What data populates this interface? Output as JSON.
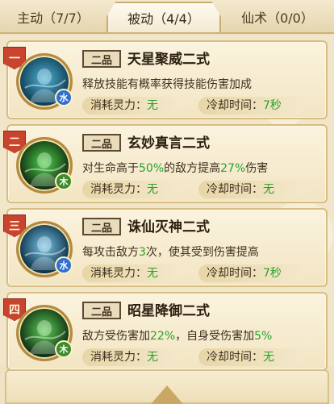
{
  "tabs": [
    {
      "label": "主动（7/7）"
    },
    {
      "label": "被动（4/4）"
    },
    {
      "label": "仙术（0/0）"
    }
  ],
  "active_tab": 1,
  "cost_label": "消耗灵力：",
  "cooldown_label": "冷却时间：",
  "skills": [
    {
      "rank": "一",
      "grade": "二品",
      "name": "天星聚威二式",
      "desc": [
        {
          "t": "释放技能有概率获得技能伤害加成"
        }
      ],
      "element": "水",
      "element_color": "#2f6fd0",
      "cost": "无",
      "cooldown": "7秒",
      "icon": "water-spirit-icon",
      "icon_colors": [
        "#0e3a52",
        "#4fb4d6"
      ]
    },
    {
      "rank": "二",
      "grade": "二品",
      "name": "玄妙真言二式",
      "desc": [
        {
          "t": "对生命高于"
        },
        {
          "t": "50%",
          "hl": true
        },
        {
          "t": "的敌方提高"
        },
        {
          "t": "27%",
          "hl": true
        },
        {
          "t": "伤害"
        }
      ],
      "element": "木",
      "element_color": "#3f8a2c",
      "cost": "无",
      "cooldown": "无",
      "icon": "green-spirit-icon",
      "icon_colors": [
        "#0f2a10",
        "#4fd34a"
      ]
    },
    {
      "rank": "三",
      "grade": "二品",
      "name": "诛仙灭神二式",
      "desc": [
        {
          "t": "每攻击敌方"
        },
        {
          "t": "3",
          "hl": true
        },
        {
          "t": "次，使其受到伤害提高"
        }
      ],
      "element": "水",
      "element_color": "#2f6fd0",
      "cost": "无",
      "cooldown": "7秒",
      "icon": "sword-strike-icon",
      "icon_colors": [
        "#0b2d45",
        "#79c7e8"
      ]
    },
    {
      "rank": "四",
      "grade": "二品",
      "name": "昭星降御二式",
      "desc": [
        {
          "t": "敌方受伤害加"
        },
        {
          "t": "22%",
          "hl": true
        },
        {
          "t": "，自身受伤害加"
        },
        {
          "t": "5%",
          "hl": true
        }
      ],
      "element": "木",
      "element_color": "#3f8a2c",
      "cost": "无",
      "cooldown": "无",
      "icon": "tree-guardian-icon",
      "icon_colors": [
        "#0d2b12",
        "#5fcf55"
      ]
    }
  ]
}
